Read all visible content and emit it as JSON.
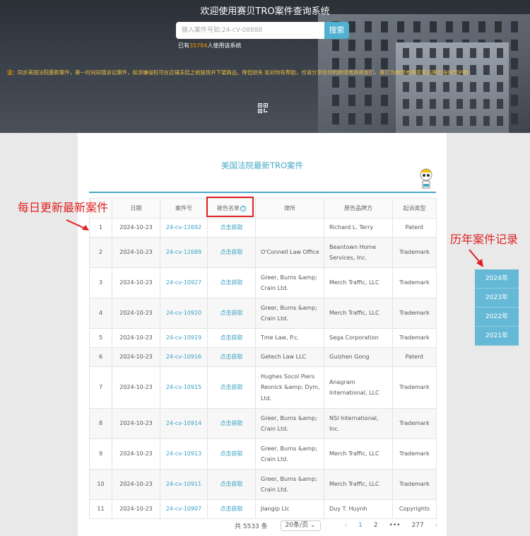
{
  "header": {
    "title": "欢迎使用赛贝TRO案件查询系统",
    "search_placeholder": "输入案件号如:24-cV-08888",
    "search_button": "搜索",
    "users_prefix": "已有",
    "users_count": "35784",
    "users_suffix": "人使用该系统",
    "notice_label": "注：",
    "notice_text": "同步美国法院最新案件，第一时间知晓诉讼案件，如涉嫌侵权可在店铺冻结之前提现并下架商品，降低损失 如对你有帮助，也请分享给你的跨境电商朋友们，赛贝为跨境电商卖家品牌出海保驾护航!"
  },
  "panel": {
    "title": "美国法院最新TRO案件",
    "columns": [
      "",
      "日期",
      "案件号",
      "被告名单",
      "律所",
      "原告品牌方",
      "起诉类型"
    ],
    "rows": [
      {
        "no": "1",
        "date": "2024-10-23",
        "case": "24-cv-12692",
        "def": "点击获取",
        "law": "",
        "plaintiff": "Richard L. Terry",
        "type": "Patent"
      },
      {
        "no": "2",
        "date": "2024-10-23",
        "case": "24-cv-12689",
        "def": "点击获取",
        "law": "O'Connell Law Office",
        "plaintiff": "Beantown Home Services, Inc.",
        "type": "Trademark"
      },
      {
        "no": "3",
        "date": "2024-10-23",
        "case": "24-cv-10927",
        "def": "点击获取",
        "law": "Greer, Burns &amp; Crain Ltd.",
        "plaintiff": "Merch Traffic, LLC",
        "type": "Trademark"
      },
      {
        "no": "4",
        "date": "2024-10-23",
        "case": "24-cv-10920",
        "def": "点击获取",
        "law": "Greer, Burns &amp; Crain Ltd.",
        "plaintiff": "Merch Traffic, LLC",
        "type": "Trademark"
      },
      {
        "no": "5",
        "date": "2024-10-23",
        "case": "24-cv-10919",
        "def": "点击获取",
        "law": "Tme Law, P.c.",
        "plaintiff": "Sega Corporation",
        "type": "Trademark"
      },
      {
        "no": "6",
        "date": "2024-10-23",
        "case": "24-cv-10916",
        "def": "点击获取",
        "law": "Getech Law LLC",
        "plaintiff": "Guizhen Gong",
        "type": "Patent"
      },
      {
        "no": "7",
        "date": "2024-10-23",
        "case": "24-cv-10915",
        "def": "点击获取",
        "law": "Hughes Socol Piers Resnick &amp; Dym, Ltd.",
        "plaintiff": "Anagram International, LLC",
        "type": "Trademark"
      },
      {
        "no": "8",
        "date": "2024-10-23",
        "case": "24-cv-10914",
        "def": "点击获取",
        "law": "Greer, Burns &amp; Crain Ltd.",
        "plaintiff": "NSI International, Inc.",
        "type": "Trademark"
      },
      {
        "no": "9",
        "date": "2024-10-23",
        "case": "24-cv-10913",
        "def": "点击获取",
        "law": "Greer, Burns &amp; Crain Ltd.",
        "plaintiff": "Merch Traffic, LLC",
        "type": "Trademark"
      },
      {
        "no": "10",
        "date": "2024-10-23",
        "case": "24-cv-10911",
        "def": "点击获取",
        "law": "Greer, Burns &amp; Crain Ltd.",
        "plaintiff": "Merch Traffic, LLC",
        "type": "Trademark"
      },
      {
        "no": "11",
        "date": "2024-10-23",
        "case": "24-cv-10907",
        "def": "点击获取",
        "law": "Jiangip Llc",
        "plaintiff": "Duy T. Huynh",
        "type": "Copyrights"
      }
    ]
  },
  "pagination": {
    "total": "共 5533 条",
    "page_size": "20条/页",
    "pages": [
      "1",
      "2",
      "•••",
      "277"
    ],
    "current": "1",
    "prev": "‹",
    "next": "›"
  },
  "annotations": {
    "left": "每日更新最新案件",
    "right": "历年案件记录"
  },
  "year_menu": [
    "2024年",
    "2023年",
    "2022年",
    "2021年"
  ],
  "colors": {
    "accent": "#49a9c8",
    "annotation_red": "#e02020",
    "year_button": "#66b9d6",
    "highlight_orange": "#ff9800"
  }
}
